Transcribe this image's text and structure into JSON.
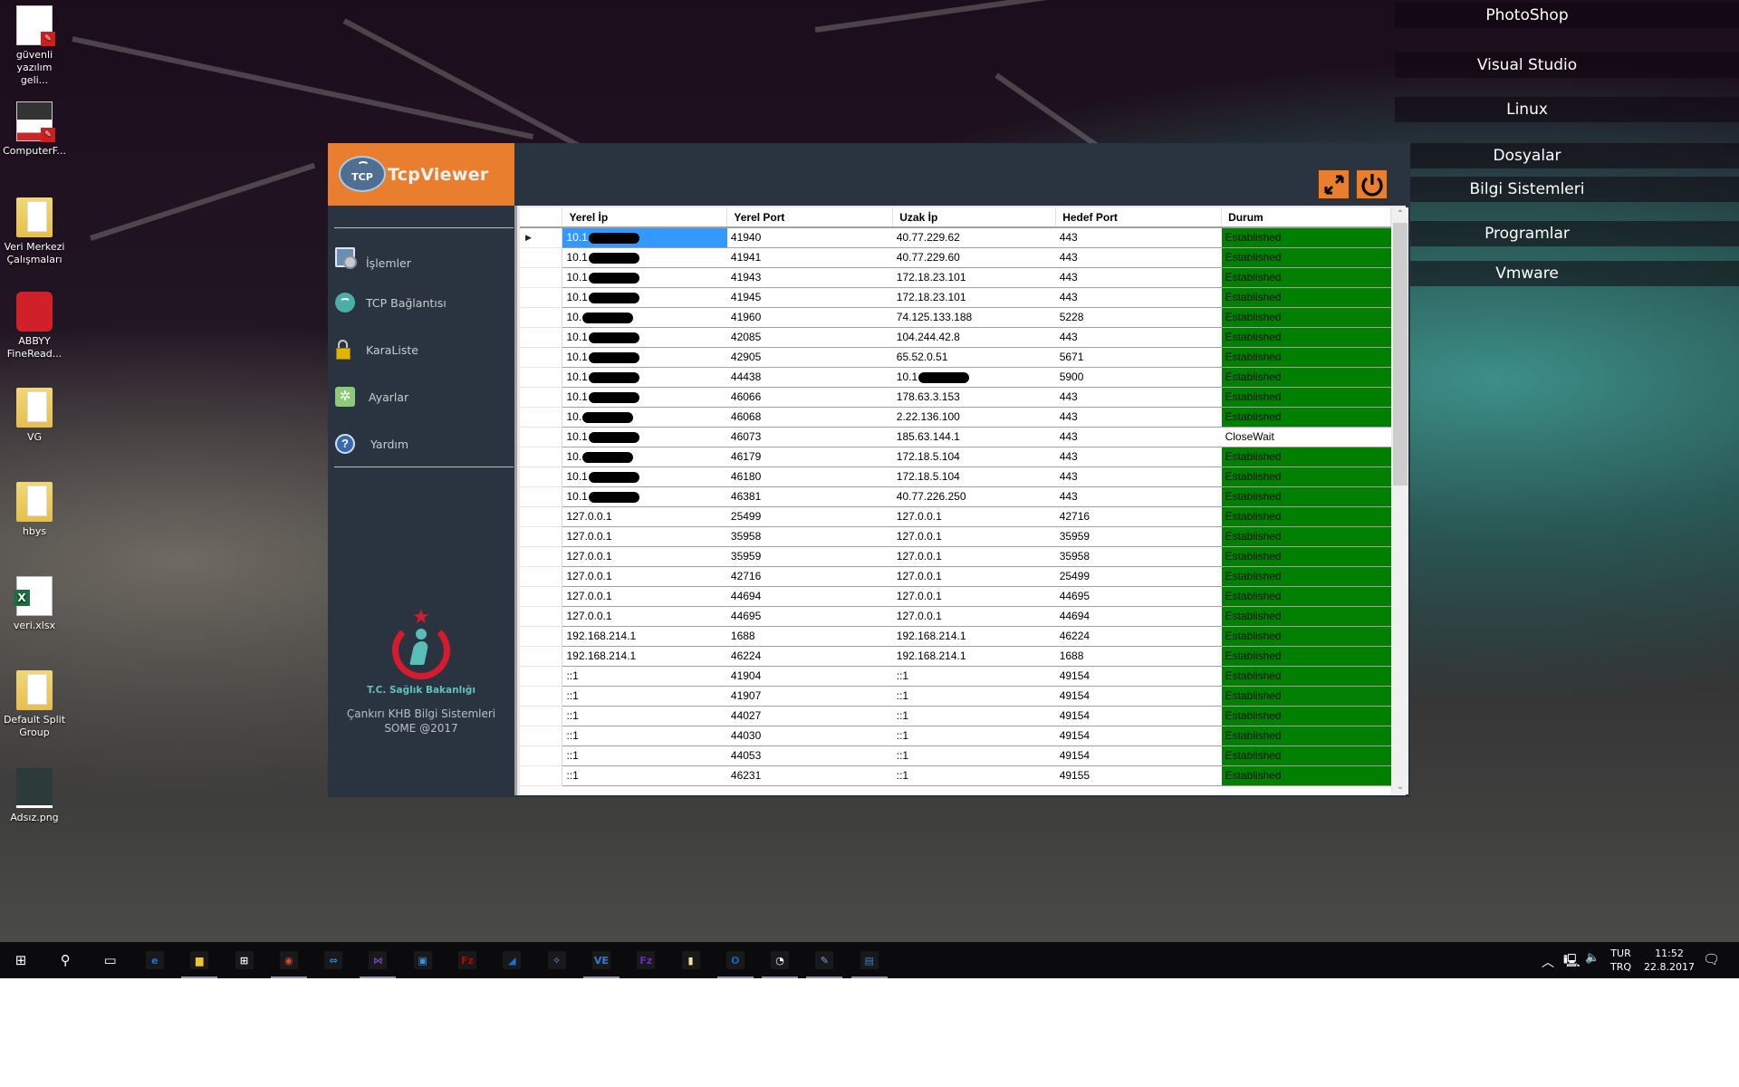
{
  "desktop": {
    "icons": [
      {
        "label": "güvenli yazılım geli...",
        "type": "pdf"
      },
      {
        "label": "ComputerF...",
        "type": "pdf"
      },
      {
        "label": "Veri Merkezi Çalışmaları",
        "type": "folder"
      },
      {
        "label": "ABBYY FineRead...",
        "type": "app"
      },
      {
        "label": "VG",
        "type": "folder"
      },
      {
        "label": "hbys",
        "type": "folder"
      },
      {
        "label": "veri.xlsx",
        "type": "excel"
      },
      {
        "label": "Default Split Group",
        "type": "folder"
      },
      {
        "label": "Adsız.png",
        "type": "image"
      }
    ],
    "right_menu": [
      "PhotoShop",
      "Visual Studio",
      "Linux",
      "Dosyalar",
      "Bilgi Sistemleri",
      "Programlar",
      "Vmware"
    ]
  },
  "app": {
    "title": "TcpViewer",
    "logo_text": "TCP",
    "accent_color": "#e87e2e",
    "toolbar": {
      "maximize_icon": "expand-arrows-icon",
      "power_icon": "power-icon"
    },
    "sidebar": {
      "items": [
        {
          "label": "İşlemler",
          "icon": "monitor-gear-icon"
        },
        {
          "label": "TCP Bağlantısı",
          "icon": "wifi-icon"
        },
        {
          "label": "KaraListe",
          "icon": "padlock-icon"
        },
        {
          "label": "Ayarlar",
          "icon": "gear-icon"
        },
        {
          "label": "Yardım",
          "icon": "help-icon"
        }
      ],
      "ministry_name": "T.C. Sağlık Bakanlığı",
      "org_line1": "Çankırı KHB Bilgi Sistemleri",
      "org_line2": "SOME @2017"
    },
    "grid": {
      "columns": [
        "Yerel İp",
        "Yerel Port",
        "Uzak İp",
        "Hedef Port",
        "Durum"
      ],
      "established_color": "#007f00",
      "selected_color": "#3399ff",
      "rows": [
        {
          "local_ip": "10.1",
          "redacted_local": true,
          "local_port": "41940",
          "remote_ip": "40.77.229.62",
          "remote_port": "443",
          "state": "Established",
          "selected": true
        },
        {
          "local_ip": "10.1",
          "redacted_local": true,
          "local_port": "41941",
          "remote_ip": "40.77.229.60",
          "remote_port": "443",
          "state": "Established"
        },
        {
          "local_ip": "10.1",
          "redacted_local": true,
          "local_port": "41943",
          "remote_ip": "172.18.23.101",
          "remote_port": "443",
          "state": "Established"
        },
        {
          "local_ip": "10.1",
          "redacted_local": true,
          "local_port": "41945",
          "remote_ip": "172.18.23.101",
          "remote_port": "443",
          "state": "Established"
        },
        {
          "local_ip": "10.",
          "redacted_local": true,
          "local_port": "41960",
          "remote_ip": "74.125.133.188",
          "remote_port": "5228",
          "state": "Established"
        },
        {
          "local_ip": "10.1",
          "redacted_local": true,
          "local_port": "42085",
          "remote_ip": "104.244.42.8",
          "remote_port": "443",
          "state": "Established"
        },
        {
          "local_ip": "10.1",
          "redacted_local": true,
          "local_port": "42905",
          "remote_ip": "65.52.0.51",
          "remote_port": "5671",
          "state": "Established"
        },
        {
          "local_ip": "10.1",
          "redacted_local": true,
          "local_port": "44438",
          "remote_ip": "10.1",
          "redacted_remote": true,
          "remote_port": "5900",
          "state": "Established"
        },
        {
          "local_ip": "10.1",
          "redacted_local": true,
          "local_port": "46066",
          "remote_ip": "178.63.3.153",
          "remote_port": "443",
          "state": "Established"
        },
        {
          "local_ip": "10.",
          "redacted_local": true,
          "local_port": "46068",
          "remote_ip": "2.22.136.100",
          "remote_port": "443",
          "state": "Established"
        },
        {
          "local_ip": "10.1",
          "redacted_local": true,
          "local_port": "46073",
          "remote_ip": "185.63.144.1",
          "remote_port": "443",
          "state": "CloseWait"
        },
        {
          "local_ip": "10.",
          "redacted_local": true,
          "local_port": "46179",
          "remote_ip": "172.18.5.104",
          "remote_port": "443",
          "state": "Established"
        },
        {
          "local_ip": "10.1",
          "redacted_local": true,
          "local_port": "46180",
          "remote_ip": "172.18.5.104",
          "remote_port": "443",
          "state": "Established"
        },
        {
          "local_ip": "10.1",
          "redacted_local": true,
          "local_port": "46381",
          "remote_ip": "40.77.226.250",
          "remote_port": "443",
          "state": "Established"
        },
        {
          "local_ip": "127.0.0.1",
          "local_port": "25499",
          "remote_ip": "127.0.0.1",
          "remote_port": "42716",
          "state": "Established"
        },
        {
          "local_ip": "127.0.0.1",
          "local_port": "35958",
          "remote_ip": "127.0.0.1",
          "remote_port": "35959",
          "state": "Established"
        },
        {
          "local_ip": "127.0.0.1",
          "local_port": "35959",
          "remote_ip": "127.0.0.1",
          "remote_port": "35958",
          "state": "Established"
        },
        {
          "local_ip": "127.0.0.1",
          "local_port": "42716",
          "remote_ip": "127.0.0.1",
          "remote_port": "25499",
          "state": "Established"
        },
        {
          "local_ip": "127.0.0.1",
          "local_port": "44694",
          "remote_ip": "127.0.0.1",
          "remote_port": "44695",
          "state": "Established"
        },
        {
          "local_ip": "127.0.0.1",
          "local_port": "44695",
          "remote_ip": "127.0.0.1",
          "remote_port": "44694",
          "state": "Established"
        },
        {
          "local_ip": "192.168.214.1",
          "local_port": "1688",
          "remote_ip": "192.168.214.1",
          "remote_port": "46224",
          "state": "Established"
        },
        {
          "local_ip": "192.168.214.1",
          "local_port": "46224",
          "remote_ip": "192.168.214.1",
          "remote_port": "1688",
          "state": "Established"
        },
        {
          "local_ip": "::1",
          "local_port": "41904",
          "remote_ip": "::1",
          "remote_port": "49154",
          "state": "Established"
        },
        {
          "local_ip": "::1",
          "local_port": "41907",
          "remote_ip": "::1",
          "remote_port": "49154",
          "state": "Established"
        },
        {
          "local_ip": "::1",
          "local_port": "44027",
          "remote_ip": "::1",
          "remote_port": "49154",
          "state": "Established"
        },
        {
          "local_ip": "::1",
          "local_port": "44030",
          "remote_ip": "::1",
          "remote_port": "49154",
          "state": "Established"
        },
        {
          "local_ip": "::1",
          "local_port": "44053",
          "remote_ip": "::1",
          "remote_port": "49154",
          "state": "Established"
        },
        {
          "local_ip": "::1",
          "local_port": "46231",
          "remote_ip": "::1",
          "remote_port": "49155",
          "state": "Established"
        }
      ]
    }
  },
  "taskbar": {
    "apps": [
      {
        "name": "start",
        "glyph": "⊞",
        "color": "#ffffff"
      },
      {
        "name": "search",
        "glyph": "⚲",
        "color": "#ffffff"
      },
      {
        "name": "task-view",
        "glyph": "▭",
        "color": "#ffffff"
      },
      {
        "name": "edge",
        "glyph": "e",
        "color": "#1a78d6"
      },
      {
        "name": "file-explorer",
        "glyph": "▆",
        "color": "#f0c23c",
        "active": true
      },
      {
        "name": "store",
        "glyph": "⊞",
        "color": "#ffffff"
      },
      {
        "name": "chrome",
        "glyph": "◉",
        "color": "#db4437",
        "active": true
      },
      {
        "name": "teamviewer",
        "glyph": "⇔",
        "color": "#0e8ee9"
      },
      {
        "name": "visual-studio",
        "glyph": "⋈",
        "color": "#7b3fb5",
        "active": true
      },
      {
        "name": "virtualbox",
        "glyph": "▣",
        "color": "#3b8fd6"
      },
      {
        "name": "filezilla",
        "glyph": "Fz",
        "color": "#bf0000"
      },
      {
        "name": "wireshark",
        "glyph": "◢",
        "color": "#1c6fd0"
      },
      {
        "name": "network-tool",
        "glyph": "✧",
        "color": "#5aa3d8"
      },
      {
        "name": "veeam",
        "glyph": "VE",
        "color": "#2b7fd6",
        "active": true
      },
      {
        "name": "filezilla-server",
        "glyph": "Fz",
        "color": "#6a2bb8"
      },
      {
        "name": "sticky-notes",
        "glyph": "▮",
        "color": "#f1e69a"
      },
      {
        "name": "outlook",
        "glyph": "O",
        "color": "#1a67b7",
        "active": true
      },
      {
        "name": "health-ministry-app",
        "glyph": "◔",
        "color": "#ffffff",
        "active": true
      },
      {
        "name": "paint",
        "glyph": "✎",
        "color": "#6aa7d6",
        "active": true
      },
      {
        "name": "tcpviewer-window",
        "glyph": "▤",
        "color": "#3b7fc6",
        "active": true
      }
    ],
    "tray": {
      "language_top": "TUR",
      "language_bottom": "TRQ",
      "time": "11:52",
      "date": "22.8.2017"
    }
  }
}
